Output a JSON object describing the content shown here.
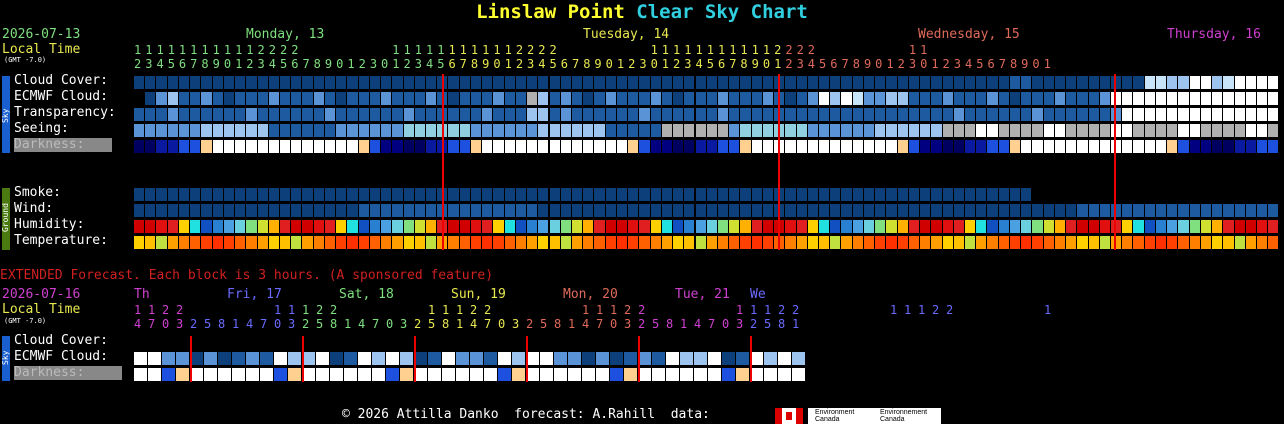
{
  "title": {
    "place": "Linslaw Point",
    "rest": "Clear Sky Chart"
  },
  "header": {
    "date": "2026-07-13",
    "local_time": "Local Time",
    "gmt": "(GMT -7.0)",
    "days": [
      {
        "label": "Monday, 13",
        "color": "#7ee07e"
      },
      {
        "label": "Tuesday, 14",
        "color": "#e8e850"
      },
      {
        "label": "Wednesday, 15",
        "color": "#e06a5a"
      },
      {
        "label": "Thursday, 16",
        "color": "#d040d0"
      }
    ],
    "hours_top": "1 1 1 1 1 1 1 1 1 1 1 2 2 2 2         1 1 1 1 1 1 1 1 1 1 1 2 2 2 2         1 1 1 1 1 1 1 1 1 1 1 2 2 2 2         1 1",
    "hours_bottom": "2 3 4 5 6 7 8 9 0 1 2 3 4 5 6 7 8 9 0 1 2 3 0 1 2 3 4 5 6 7 8 9 0 1 2 3 4 5 6 7 8 9 0 1 2 3 0 1 2 3 4 5 6 7 8 9 0 1 2 3 4 5 6 7 8 9 0 1 2 3 0 1 2 3 4 5 6 7 8 9 0 1"
  },
  "sky_tag": "Sky",
  "ground_tag": "Ground",
  "rows": {
    "cloud": "Cloud Cover:",
    "ecmwf": "ECMWF Cloud:",
    "transparency": "Transparency:",
    "seeing": "Seeing:",
    "darkness": "Darkness:",
    "smoke": "Smoke:",
    "wind": "Wind:",
    "humidity": "Humidity:",
    "temperature": "Temperature:"
  },
  "extended": {
    "notice": "EXTENDED Forecast. Each block is 3 hours. (A sponsored feature)",
    "date": "2026-07-16",
    "local_time": "Local Time",
    "gmt": "(GMT -7.0)",
    "days": [
      {
        "label": "Th",
        "color": "#d040d0"
      },
      {
        "label": "Fri, 17",
        "color": "#6a6aff"
      },
      {
        "label": "Sat, 18",
        "color": "#7ee07e"
      },
      {
        "label": "Sun, 19",
        "color": "#e8e850"
      },
      {
        "label": "Mon, 20",
        "color": "#e06a5a"
      },
      {
        "label": "Tue, 21",
        "color": "#d040d0"
      },
      {
        "label": "We",
        "color": "#6a6aff"
      }
    ],
    "hours_top": "1 1 2 2       1 1 1 2 2       1 1 1 2 2       1 1 1 2 2       1 1 1 2 2       1 1 1 2 2       1",
    "hours_bottom": "4 7 0 3 2 5 8 1 4 7 0 3 2 5 8 1 4 7 0 3 2 5 8 1 4 7 0 3 2 5 8 1 4 7 0 3 2 5 8 1 4 7 0 3 2 5 8 1"
  },
  "footer": {
    "copyright": "© 2026 Attilla Danko  forecast: A.Rahill  data:",
    "logo1": "Environment Canada",
    "logo2": "Environnement Canada"
  }
}
